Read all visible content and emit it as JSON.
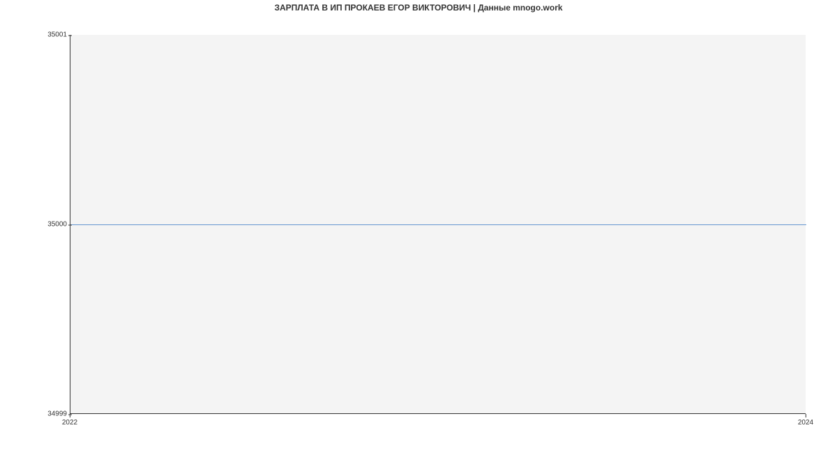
{
  "chart_data": {
    "type": "line",
    "title": "ЗАРПЛАТА В ИП ПРОКАЕВ ЕГОР ВИКТОРОВИЧ | Данные mnogo.work",
    "x": [
      2022,
      2024
    ],
    "values": [
      35000,
      35000
    ],
    "xlabel": "",
    "ylabel": "",
    "x_ticks": [
      "2022",
      "2024"
    ],
    "y_ticks": [
      "34999",
      "35000",
      "35001"
    ],
    "ylim": [
      34999,
      35001
    ],
    "xlim": [
      2022,
      2024
    ],
    "line_color": "#6596cf",
    "grid": false
  }
}
